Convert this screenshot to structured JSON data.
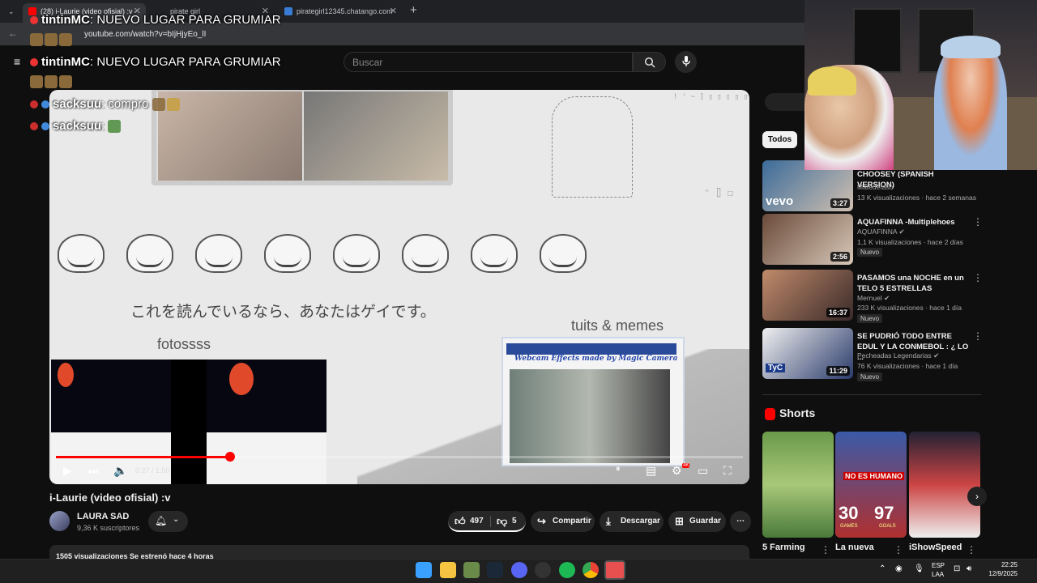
{
  "browser": {
    "tabs": [
      {
        "label": "(28) i-Laurie (video ofisial) :v -",
        "active": true
      },
      {
        "label": "pirate girl",
        "active": false
      },
      {
        "label": "pirategirl12345.chatango.com",
        "active": false
      }
    ],
    "url": "youtube.com/watch?v=bIjHjyEo_lI",
    "new_tab": "+"
  },
  "chat_overlay": {
    "lines": [
      {
        "user": "tintinMC",
        "message": ": NUEVO LUGAR PARA GRUMIAR"
      },
      {
        "user": "tintinMC",
        "message": ": NUEVO LUGAR PARA GRUMIAR"
      },
      {
        "user": "sacksuu",
        "message": ": compro"
      },
      {
        "user": "sacksuu",
        "message": ":"
      }
    ]
  },
  "search": {
    "placeholder": "Buscar"
  },
  "video": {
    "overlay_jp": "これを読んでいるなら、あなたはゲイです。",
    "overlay_tuits": "tuits & memes",
    "overlay_fotos": "fotossss",
    "webcam_caption": "Webcam Effects made by Magic Camera",
    "time_current": "0:27",
    "time_total": "1:50",
    "progress_fraction": 0.254,
    "hd_badge": "4K"
  },
  "info": {
    "title": "i-Laurie (video ofisial) :v",
    "channel": "LAURA SAD",
    "subscribers": "9,36 K suscriptores",
    "likes": "497",
    "dislikes": "5",
    "share": "Compartir",
    "download": "Descargar",
    "save": "Guardar",
    "description": "1505 visualizaciones  Se estrenó hace 4 horas"
  },
  "sidebar": {
    "chip": "Todos",
    "recs": [
      {
        "title": "CHOOSEY (SPANISH VERSION)",
        "channel": "Matedefaso",
        "meta": "13 K visualizaciones · hace 2 semanas",
        "duration": "3:27",
        "badge": "",
        "verified": false
      },
      {
        "title": "AQUAFINNA -Multiplehoes",
        "channel": "AQUAFINNA",
        "meta": "1,1 K visualizaciones · hace 2 días",
        "duration": "2:56",
        "badge": "Nuevo",
        "verified": true
      },
      {
        "title": "PASAMOS una NOCHE en un TELO 5 ESTRELLAS",
        "channel": "Mernuel",
        "meta": "233 K visualizaciones · hace 1 día",
        "duration": "16:37",
        "badge": "Nuevo",
        "verified": true
      },
      {
        "title": "SE PUDRIÓ TODO ENTRE EDUL Y LA CONMEBOL : ¿ LO ...",
        "channel": "Pecheadas Legendarias",
        "meta": "76 K visualizaciones · hace 1 día",
        "duration": "11:29",
        "badge": "Nuevo",
        "verified": true
      }
    ],
    "shorts_heading": "Shorts",
    "shorts": [
      {
        "title": "5 Farming",
        "overlay": ""
      },
      {
        "title": "La nueva",
        "overlay": "NO ES HUMANO"
      },
      {
        "title": "iShowSpeed",
        "overlay": ""
      }
    ],
    "short2_games": "30",
    "short2_games_label": "GAMES",
    "short2_goals": "97",
    "short2_goals_label": "GOALS"
  },
  "taskbar": {
    "lang_line1": "ESP",
    "lang_line2": "LAA",
    "time": "22:25",
    "date": "12/9/2025"
  },
  "colors": {
    "accent_red": "#ff0000",
    "bg": "#0f0f0f"
  }
}
